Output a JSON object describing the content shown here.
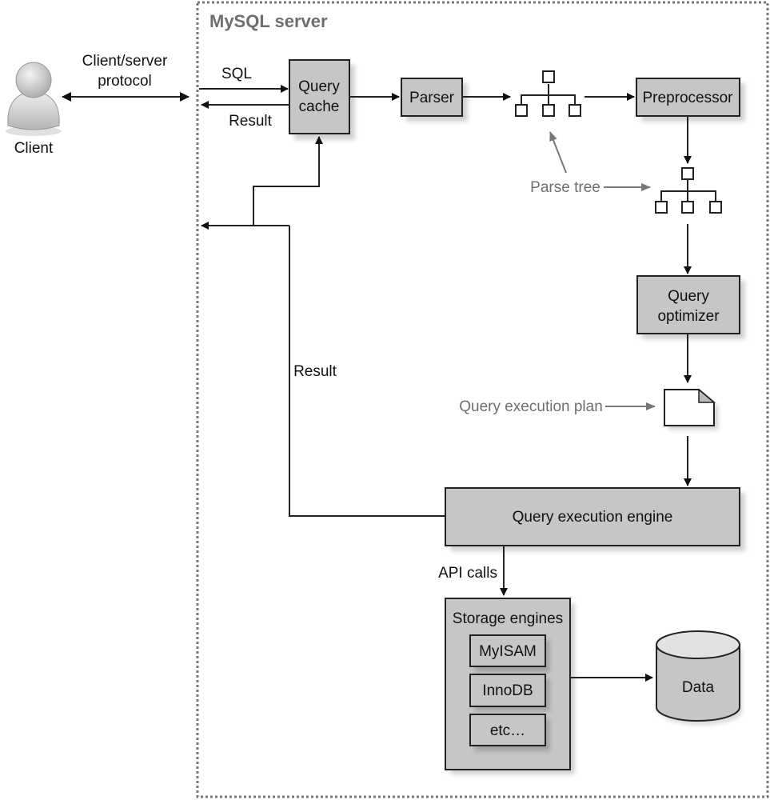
{
  "diagram": {
    "title": "MySQL server",
    "client": {
      "label": "Client",
      "icon": "user-icon"
    },
    "protocol_label_line1": "Client/server",
    "protocol_label_line2": "protocol",
    "sql_label": "SQL",
    "result_label_top": "Result",
    "result_label_left": "Result",
    "nodes": {
      "query_cache": {
        "line1": "Query",
        "line2": "cache"
      },
      "parser": {
        "label": "Parser"
      },
      "preprocessor": {
        "label": "Preprocessor"
      },
      "query_optimizer": {
        "line1": "Query",
        "line2": "optimizer"
      },
      "execution_engine": {
        "label": "Query execution engine"
      },
      "storage_engines": {
        "label": "Storage engines",
        "items": [
          "MyISAM",
          "InnoDB",
          "etc…"
        ]
      },
      "data": {
        "label": "Data",
        "icon": "database-icon"
      }
    },
    "annotations": {
      "parse_tree": "Parse tree",
      "execution_plan": "Query execution plan",
      "api_calls": "API calls"
    }
  }
}
